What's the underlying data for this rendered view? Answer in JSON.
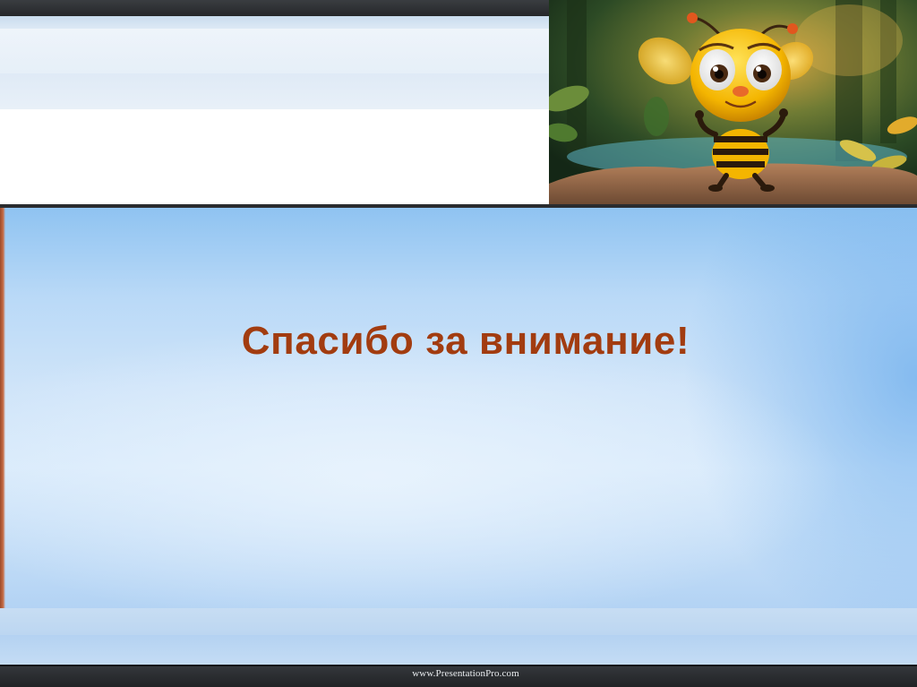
{
  "slide": {
    "title": "Спасибо за внимание!",
    "footer_text": "www.PresentationPro.com",
    "picture_icon": "cartoon-bee-icon"
  },
  "colors": {
    "title": "#a23c10",
    "header_bar": "#2a2c2f",
    "background_blue": "#b9d9f7",
    "footer_bar": "#25272a",
    "accent_edge": "#c76e47"
  }
}
